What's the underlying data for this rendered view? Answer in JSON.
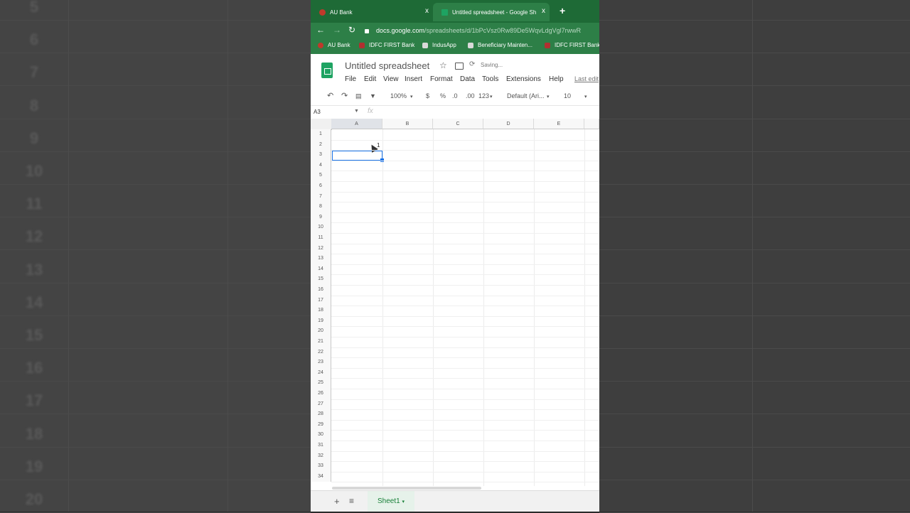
{
  "background": {
    "row_numbers": [
      "5",
      "6",
      "7",
      "8",
      "9",
      "10",
      "11",
      "12",
      "13",
      "14",
      "15",
      "16",
      "17",
      "18",
      "19",
      "20"
    ]
  },
  "browser": {
    "tabs": [
      {
        "title": "AU Bank",
        "active": false
      },
      {
        "title": "Untitled spreadsheet - Google Sh",
        "active": true
      }
    ],
    "new_tab": "+",
    "close": "x",
    "url_host": "docs.google.com",
    "url_path": "/spreadsheets/d/1bPcVsz0Rw89De5WqvLdgVgl7rwwR",
    "bookmarks": [
      "AU Bank",
      "IDFC FIRST Bank",
      "IndusApp",
      "Beneficiary Mainten...",
      "IDFC FIRST Bank"
    ]
  },
  "sheets": {
    "title": "Untitled spreadsheet",
    "status": "Saving...",
    "menu": [
      "File",
      "Edit",
      "View",
      "Insert",
      "Format",
      "Data",
      "Tools",
      "Extensions",
      "Help"
    ],
    "last_edit": "Last edit",
    "toolbar": {
      "zoom": "100%",
      "currency": "$",
      "percent": "%",
      "decrease_decimal": ".0",
      "increase_decimal": ".00",
      "more_formats": "123",
      "font": "Default (Ari...",
      "font_size": "10"
    },
    "name_box": "A3",
    "fx": "fx",
    "columns": [
      "A",
      "B",
      "C",
      "D",
      "E"
    ],
    "rows": [
      "1",
      "2",
      "3",
      "4",
      "5",
      "6",
      "7",
      "8",
      "9",
      "10",
      "11",
      "12",
      "13",
      "14",
      "15",
      "16",
      "17",
      "18",
      "19",
      "20",
      "21",
      "22",
      "23",
      "24",
      "25",
      "26",
      "27",
      "28",
      "29",
      "30",
      "31",
      "32",
      "33",
      "34"
    ],
    "cell_A2": "1",
    "sheet_tab": "Sheet1",
    "add_sheet": "+",
    "all_sheets": "≡"
  },
  "colors": {
    "chrome_green": "#1e6a36",
    "selection_blue": "#1a73e8",
    "sheets_green": "#1ea362"
  }
}
